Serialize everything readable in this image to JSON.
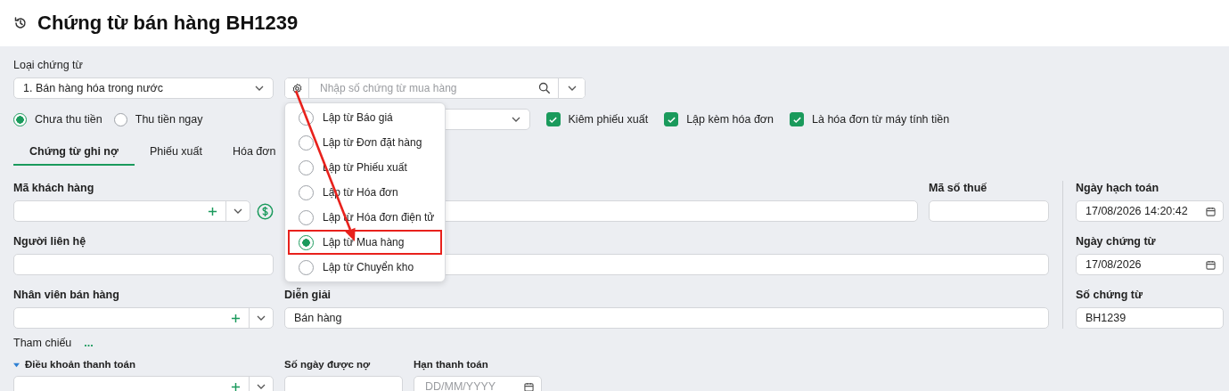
{
  "page": {
    "title": "Chứng từ bán hàng BH1239"
  },
  "voucher_type": {
    "label": "Loại chứng từ",
    "value": "1. Bán hàng hóa trong nước"
  },
  "source_search": {
    "placeholder": "Nhập số chứng từ mua hàng"
  },
  "source_menu": {
    "expanded": true,
    "items": [
      {
        "label": "Lập từ Báo giá",
        "selected": false
      },
      {
        "label": "Lập từ Đơn đặt hàng",
        "selected": false
      },
      {
        "label": "Lập từ Phiếu xuất",
        "selected": false
      },
      {
        "label": "Lập từ Hóa đơn",
        "selected": false
      },
      {
        "label": "Lập từ Hóa đơn điện tử",
        "selected": false
      },
      {
        "label": "Lập từ Mua hàng",
        "selected": true
      },
      {
        "label": "Lập từ Chuyển kho",
        "selected": false
      }
    ]
  },
  "payment_options": [
    {
      "label": "Chưa thu tiền",
      "selected": true
    },
    {
      "label": "Thu tiền ngay",
      "selected": false
    }
  ],
  "options": [
    {
      "label": "Kiêm phiếu xuất",
      "checked": true
    },
    {
      "label": "Lập kèm hóa đơn",
      "checked": true
    },
    {
      "label": "Là hóa đơn từ máy tính tiền",
      "checked": true
    }
  ],
  "tabs": [
    {
      "label": "Chứng từ ghi nợ",
      "selected": true
    },
    {
      "label": "Phiếu xuất",
      "selected": false
    },
    {
      "label": "Hóa đơn",
      "selected": false
    }
  ],
  "customer": {
    "label": "Mã khách hàng"
  },
  "tax_code": {
    "label": "Mã số thuế"
  },
  "contact": {
    "label": "Người liên hệ"
  },
  "salesperson": {
    "label": "Nhân viên bán hàng"
  },
  "description": {
    "label": "Diễn giải",
    "value": "Bán hàng"
  },
  "posting_date": {
    "label": "Ngày hạch toán",
    "value": "17/08/2026 14:20:42"
  },
  "voucher_date": {
    "label": "Ngày chứng từ",
    "value": "17/08/2026"
  },
  "voucher_number": {
    "label": "Số chứng từ",
    "value": "BH1239"
  },
  "reference": {
    "label": "Tham chiếu",
    "more": "..."
  },
  "payment_terms": {
    "label": "Điều khoản thanh toán",
    "expanded": true
  },
  "credit_days": {
    "label": "Số ngày được nợ"
  },
  "due_date": {
    "label": "Hạn thanh toán",
    "placeholder": "DD/MM/YYYY"
  }
}
